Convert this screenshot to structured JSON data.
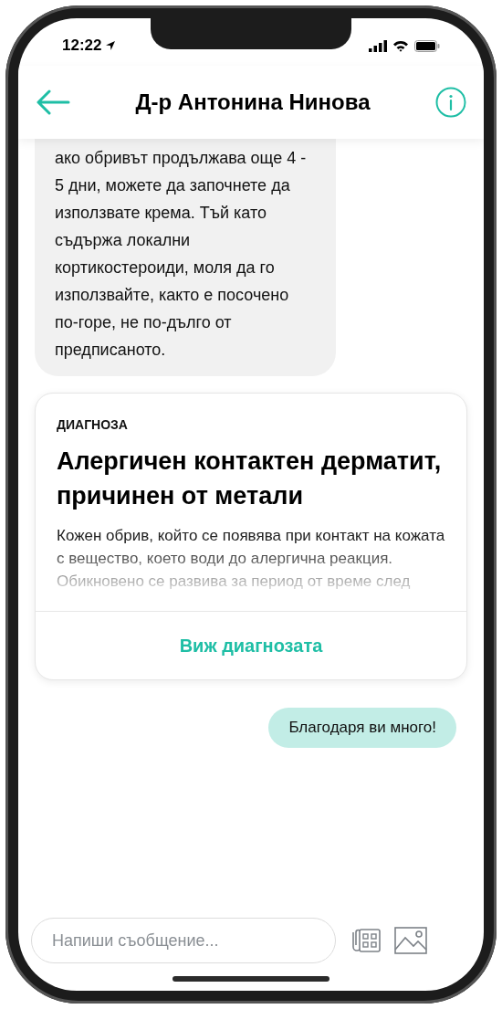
{
  "status_bar": {
    "time": "12:22"
  },
  "header": {
    "title": "Д-р Антонина Нинова"
  },
  "messages": [
    {
      "kind": "incoming",
      "text": "ако обривът продължава още 4 - 5 дни, можете да започнете да използвате крема. Тъй като съдържа локални кортикостероиди, моля да го използвайте, както е посочено по-горе, не по-дълго от предписаното."
    },
    {
      "kind": "diagnosis",
      "label": "ДИАГНОЗА",
      "title": "Алергичен контактен дерматит, причинен от метали",
      "description": "Кожен обрив, който се появява при контакт на кожата с вещество, което води до алергична реакция. Обикновено се развива за период от време след",
      "action": "Виж диагнозата"
    },
    {
      "kind": "outgoing",
      "text": "Благодаря ви много!"
    }
  ],
  "composer": {
    "placeholder": "Напиши съобщение..."
  }
}
